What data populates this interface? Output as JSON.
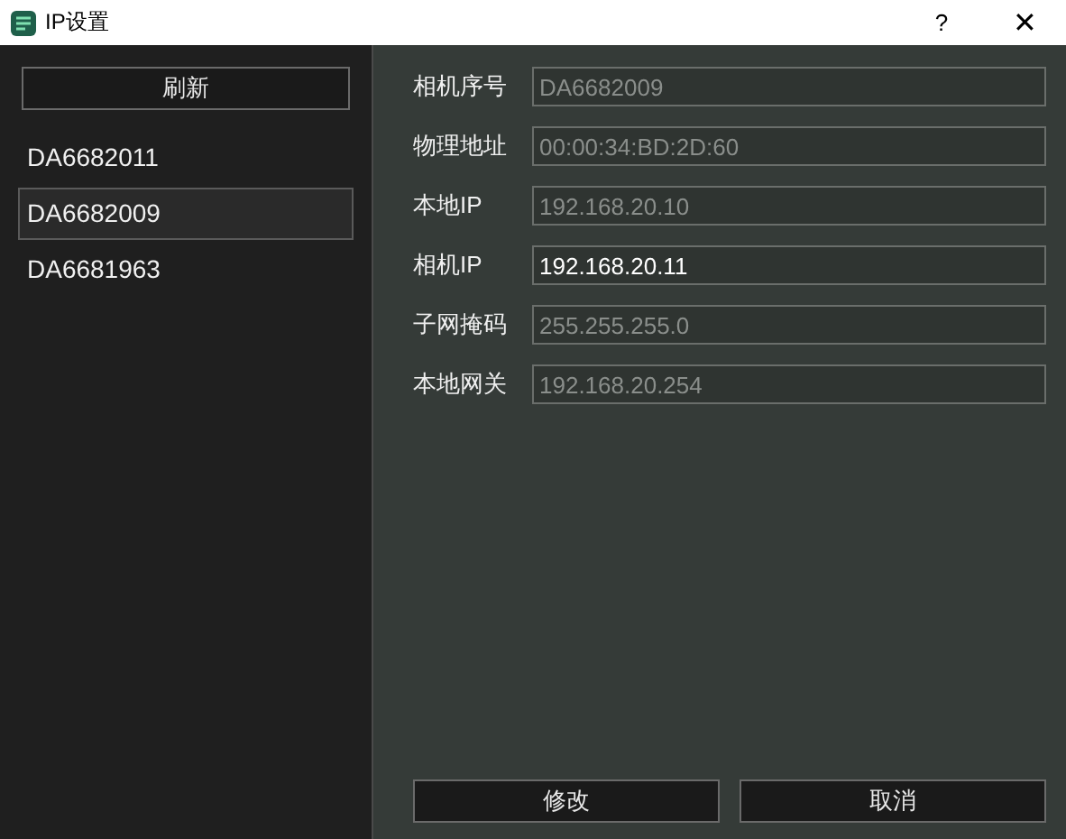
{
  "window": {
    "title": "IP设置",
    "help": "?",
    "close": "✕"
  },
  "sidebar": {
    "refresh_button": "刷新",
    "items": [
      {
        "label": "DA6682011",
        "selected": false
      },
      {
        "label": "DA6682009",
        "selected": true
      },
      {
        "label": "DA6681963",
        "selected": false
      }
    ]
  },
  "fields": [
    {
      "label": "相机序号",
      "value": "DA6682009",
      "disabled": true
    },
    {
      "label": "物理地址",
      "value": "00:00:34:BD:2D:60",
      "disabled": true
    },
    {
      "label": "本地IP",
      "value": "192.168.20.10",
      "disabled": true
    },
    {
      "label": "相机IP",
      "value": "192.168.20.11",
      "disabled": false
    },
    {
      "label": "子网掩码",
      "value": "255.255.255.0",
      "disabled": true
    },
    {
      "label": "本地网关",
      "value": "192.168.20.254",
      "disabled": true
    }
  ],
  "buttons": [
    "修改",
    "取消"
  ]
}
